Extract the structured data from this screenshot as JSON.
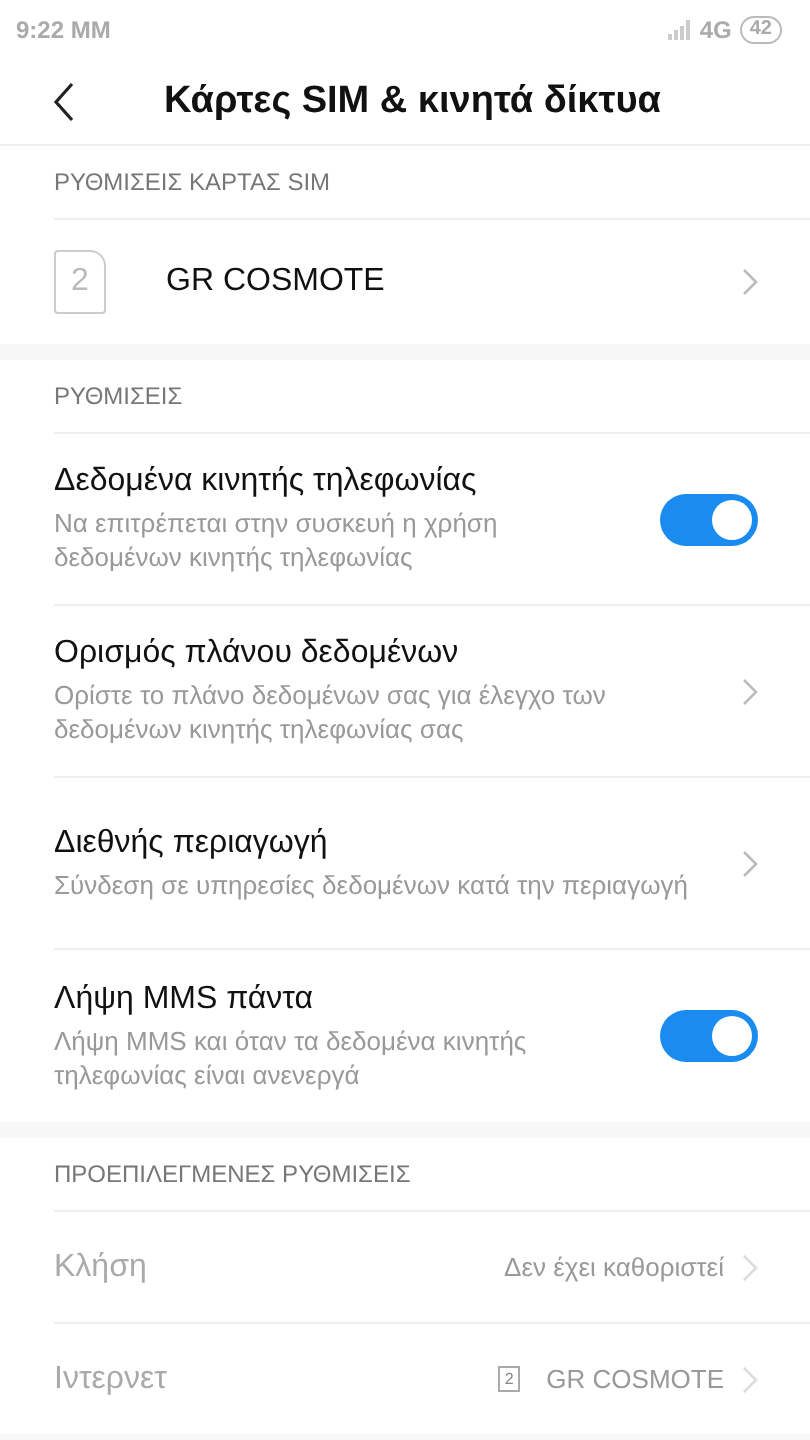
{
  "status_bar": {
    "time": "9:22 MM",
    "network": "4G",
    "battery": "42"
  },
  "header": {
    "title": "Κάρτες SIM & κινητά δίκτυα"
  },
  "sections": [
    {
      "title": "ΡΥΘΜΙΣΕΙΣ ΚΑΡΤΑΣ SIM",
      "items": [
        {
          "kind": "sim",
          "slot": "2",
          "label": "GR COSMOTE"
        }
      ]
    },
    {
      "title": "ΡΥΘΜΙΣΕΙΣ",
      "items": [
        {
          "kind": "toggle",
          "label": "Δεδομένα κινητής τηλεφωνίας",
          "description": "Να επιτρέπεται στην συσκευή η χρήση δεδομένων κινητής τηλεφωνίας",
          "on": true
        },
        {
          "kind": "link",
          "label": "Ορισμός πλάνου δεδομένων",
          "description": "Ορίστε το πλάνο δεδομένων σας για έλεγχο των δεδομένων κινητής τηλεφωνίας σας"
        },
        {
          "kind": "link",
          "label": "Διεθνής περιαγωγή",
          "description": "Σύνδεση σε υπηρεσίες δεδομένων κατά την περιαγωγή"
        },
        {
          "kind": "toggle",
          "label": "Λήψη MMS πάντα",
          "description": "Λήψη MMS και όταν τα δεδομένα κινητής τηλεφωνίας είναι ανενεργά",
          "on": true
        }
      ]
    },
    {
      "title": "ΠΡΟΕΠΙΛΕΓΜΕΝΕΣ ΡΥΘΜΙΣΕΙΣ",
      "items": [
        {
          "kind": "value",
          "label": "Κλήση",
          "value": "Δεν έχει καθοριστεί",
          "disabled": true
        },
        {
          "kind": "value",
          "label": "Ιντερνετ",
          "slot": "2",
          "value": "GR COSMOTE",
          "disabled": true
        }
      ]
    }
  ]
}
